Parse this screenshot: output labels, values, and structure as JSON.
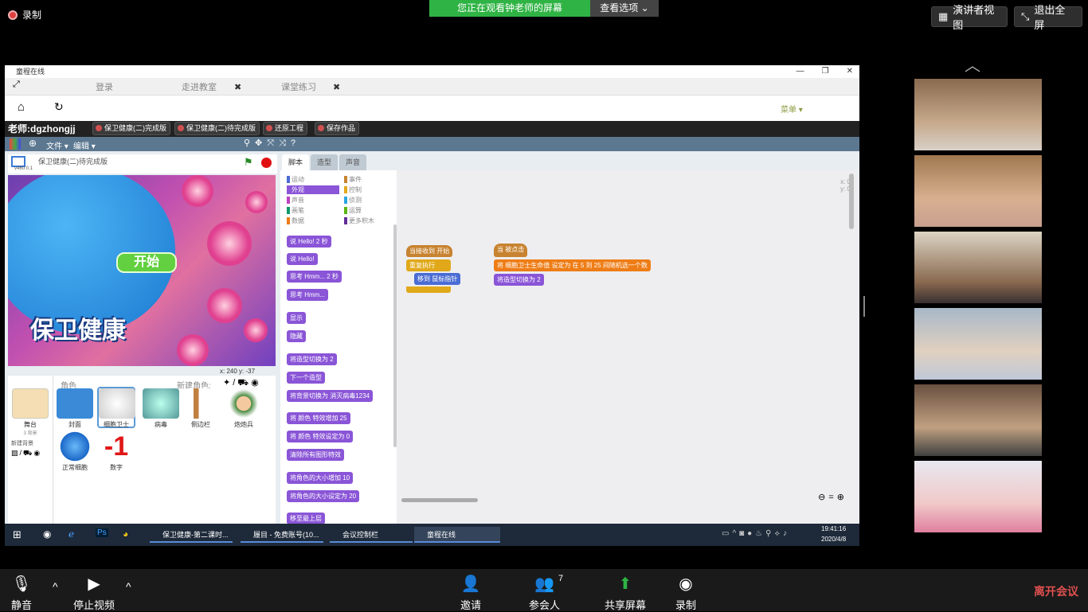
{
  "zoom": {
    "recording_label": "录制",
    "viewing_banner": "您正在观看钟老师的屏幕",
    "view_options": "查看选项",
    "speaker_view": "演讲者视图",
    "exit_fullscreen": "退出全屏",
    "participants_count": "7",
    "bottom": {
      "mute": "静音",
      "stop_video": "停止视频",
      "invite": "邀请",
      "participants": "参会人",
      "share_screen": "共享屏幕",
      "record": "录制",
      "leave": "离开会议"
    }
  },
  "app": {
    "window_title": "童程在线",
    "tabs": [
      {
        "label": "登录"
      },
      {
        "label": "走进教室"
      },
      {
        "label": "课堂练习"
      }
    ],
    "menu_label": "菜单",
    "teacher": "老师:dgzhongjj",
    "teacher_buttons": [
      "保卫健康(二)完成版",
      "保卫健康(二)待完成版",
      "还原工程",
      "保存作品"
    ],
    "scratch_menu": [
      "文件",
      "编辑"
    ],
    "project_title": "保卫健康(二)待完成版",
    "version": "v460.0.1",
    "stage_title_text": "保卫健康",
    "start_button": "开始",
    "stage_coords": "x: 240   y: -37",
    "sprites_header": "角色",
    "new_sprite": "新建角色:",
    "stage_label": "舞台",
    "stage_backdrops": "3 背景",
    "new_backdrop": "新建背景",
    "sprites": [
      "封面",
      "细胞卫士",
      "病毒",
      "侧边栏",
      "炮炮兵",
      "正常细胞",
      "数字"
    ],
    "number_sprite_glyph": "-1",
    "editor_tabs": [
      "脚本",
      "造型",
      "声音"
    ],
    "categories_left": [
      "运动",
      "外观",
      "声音",
      "画笔",
      "数据"
    ],
    "categories_right": [
      "事件",
      "控制",
      "侦测",
      "运算",
      "更多积木"
    ],
    "palette_blocks": [
      "说 Hello! 2 秒",
      "说 Hello!",
      "思考 Hmm... 2 秒",
      "思考 Hmm...",
      "显示",
      "隐藏",
      "将造型切换为 2",
      "下一个造型",
      "将背景切换为 消灭病毒1234",
      "将 颜色 特效增加 25",
      "将 颜色 特效设定为 0",
      "清除所有图形特效",
      "将角色的大小增加 10",
      "将角色的大小设定为 20",
      "移至最上层"
    ],
    "script1": {
      "hat": "当接收到 开始",
      "forever": "重复执行",
      "move": "移到 鼠标指针"
    },
    "script2": {
      "hat": "当 被点击",
      "set": "将 细胞卫士生命值 设定为 在 5 到 25 间随机选一个数",
      "costume": "将造型切换为 2"
    },
    "xy_readout": "x: 0\ny: 0"
  },
  "taskbar": {
    "items": [
      "保卫健康-第二课时...",
      "履目 - 免费账号(10...",
      "会议控制栏",
      "童程在线"
    ],
    "time": "19:41:16",
    "date": "2020/4/8"
  }
}
